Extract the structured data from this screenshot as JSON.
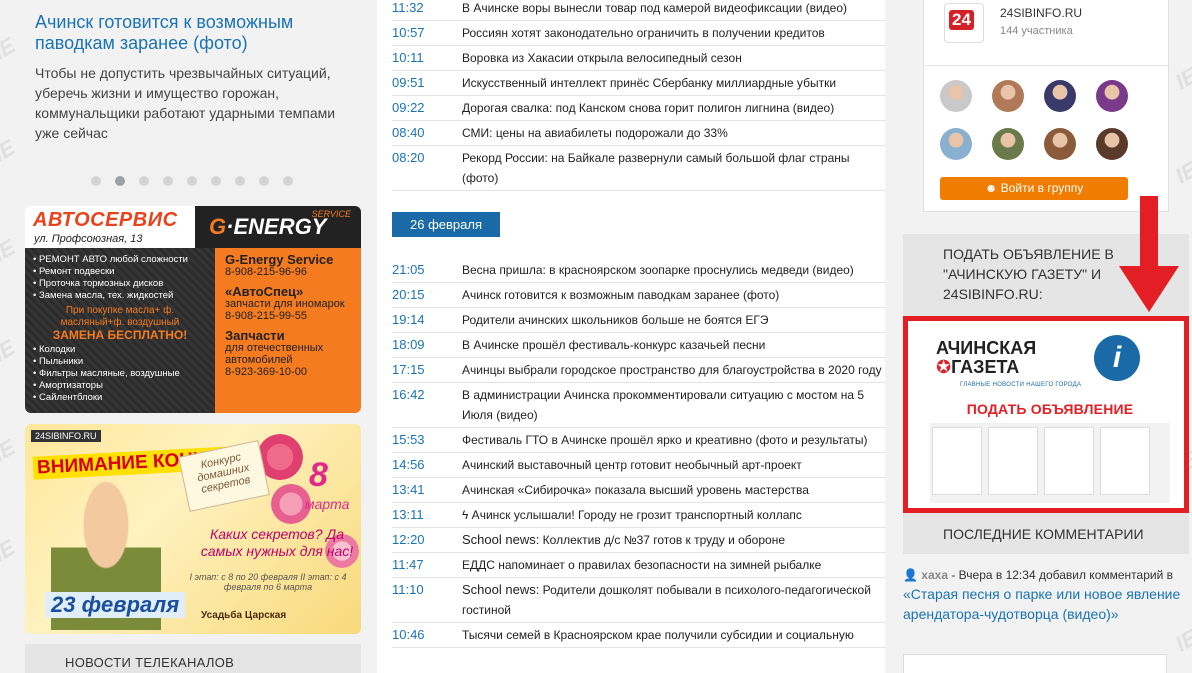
{
  "slider": {
    "title": "Ачинск готовится к возможным паводкам заранее (фото)",
    "text": "Чтобы не допустить чрезвычайных ситуаций, уберечь жизни и имущество горожан, коммунальщики работают ударными темпами уже сейчас"
  },
  "ad_autoservice": {
    "title": "АВТОСЕРВИС",
    "address": "ул. Профсоюзная, 13",
    "brand_a": "G",
    "brand_b": "ENERGY",
    "brand_tag": "SERVICE",
    "services": [
      "РЕМОНТ АВТО любой сложности",
      "Ремонт подвески",
      "Проточка тормозных дисков",
      "Замена масла, тех. жидкостей"
    ],
    "promo": "При покупке масла+ ф. масляный+ф. воздушный",
    "promo_free": "ЗАМЕНА БЕСПЛАТНО!",
    "parts": [
      "Колодки",
      "Пыльники",
      "Фильтры масляные, воздушные",
      "Амортизаторы",
      "Сайлентблоки"
    ],
    "contacts": [
      {
        "name": "G-Energy Service",
        "desc": "",
        "phone": "8-908-215-96-96"
      },
      {
        "name": "«АвтоСпец»",
        "desc": "запчасти для иномарок",
        "phone": "8-908-215-99-55"
      },
      {
        "name": "Запчасти",
        "desc": "для отечественных автомобилей",
        "phone": "8-923-369-10-00"
      }
    ]
  },
  "ad_contest": {
    "logos": "24SIBINFO.RU",
    "attention": "ВНИМАНИЕ КОНКУРС!",
    "contest_name": "Конкурс домашних секретов",
    "eight": "8",
    "march": "марта",
    "question": "Каких секретов? Да самых нужных для нас!",
    "stages": "I этап: с 8 по 20 февраля   II этап: с 4 февраля по 6 марта",
    "feb23": "23 февраля",
    "usadba": "Усадьба Царская"
  },
  "tv_news_heading": "НОВОСТИ ТЕЛЕКАНАЛОВ",
  "news_top": [
    {
      "time": "11:32",
      "title": "В Ачинске воры вынесли товар под камерой видеофиксации (видео)"
    },
    {
      "time": "10:57",
      "title": "Россиян хотят законодательно ограничить в получении кредитов"
    },
    {
      "time": "10:11",
      "title": "Воровка из Хакасии открыла велосипедный сезон"
    },
    {
      "time": "09:51",
      "title": "Искусственный интеллект принёс Сбербанку миллиардные убытки"
    },
    {
      "time": "09:22",
      "title": "Дорогая свалка: под Канском снова горит полигон лигнина (видео)"
    },
    {
      "time": "08:40",
      "title": "СМИ: цены на авиабилеты подорожали до 33%"
    },
    {
      "time": "08:20",
      "title": "Рекорд России: на Байкале развернули самый большой флаг страны (фото)"
    }
  ],
  "date_badge": "26 февраля",
  "news_bottom": [
    {
      "time": "21:05",
      "title": "Весна пришла: в красноярском зоопарке проснулись медведи (видео)"
    },
    {
      "time": "20:15",
      "title": "Ачинск готовится к возможным паводкам заранее (фото)"
    },
    {
      "time": "19:14",
      "title": "Родители ачинских школьников больше не боятся ЕГЭ"
    },
    {
      "time": "18:09",
      "title": "В Ачинске прошёл фестиваль-конкурс казачьей песни"
    },
    {
      "time": "17:15",
      "title": "Ачинцы выбрали городское пространство для благоустройства в 2020 году"
    },
    {
      "time": "16:42",
      "title": "В администрации Ачинска прокомментировали ситуацию с мостом на 5 Июля (видео)"
    },
    {
      "time": "15:53",
      "title": "Фестиваль ГТО в Ачинске прошёл ярко и креативно (фото и результаты)"
    },
    {
      "time": "14:56",
      "title": "Ачинский выставочный центр готовит необычный арт-проект"
    },
    {
      "time": "13:41",
      "title": "Ачинская «Сибирочка» показала высший уровень мастерства"
    },
    {
      "time": "13:11",
      "title": "ϟ Ачинск услышали! Городу не грозит транспортный коллапс"
    },
    {
      "time": "12:20",
      "prefix": "School news:",
      "title": " Коллектив д/с №37 готов к труду и обороне"
    },
    {
      "time": "11:47",
      "title": "ЕДДС напоминает о правилах безопасности на зимней рыбалке"
    },
    {
      "time": "11:10",
      "prefix": "School news:",
      "title": " Родители дошколят побывали в психолого-педагогической гостиной"
    },
    {
      "time": "10:46",
      "title": "Тысячи семей в Красноярском крае получили субсидии и социальную"
    }
  ],
  "ok_group": {
    "logo_text": "24",
    "name": "24SIBINFO.RU",
    "members": "144 участника",
    "join_label": "Войти в группу",
    "avatar_colors": [
      "#c9c9c9",
      "#b07a5a",
      "#3a3a6a",
      "#7a3a8a",
      "#8ab0d0",
      "#6a7a4a",
      "#8a5a3a",
      "#5a3a2a"
    ]
  },
  "ad_panel": {
    "heading": "ПОДАТЬ ОБЪЯВЛЕНИЕ В \"АЧИНСКУЮ ГАЗЕТУ\" И 24SIBINFO.RU:",
    "logo_line1": "АЧИНСКАЯ",
    "logo_line2": "ГАЗЕТА",
    "logo_sub": "ГЛАВНЫЕ НОВОСТИ НАШЕГО ГОРОДА",
    "circle": "i",
    "post_label": "ПОДАТЬ ОБЪЯВЛЕНИЕ"
  },
  "comments": {
    "heading": "ПОСЛЕДНИЕ КОММЕНТАРИИ",
    "user": "хаха",
    "when": " - Вчера в 12:34 добавил комментарий в ",
    "link": "«Старая песня о парке или новое явление арендатора-чудотворца (видео)»"
  },
  "colors": {
    "link_blue": "#1a73b5",
    "date_badge": "#1a6aa7",
    "ok_orange": "#f07c00",
    "highlight_red": "#e31e24"
  }
}
